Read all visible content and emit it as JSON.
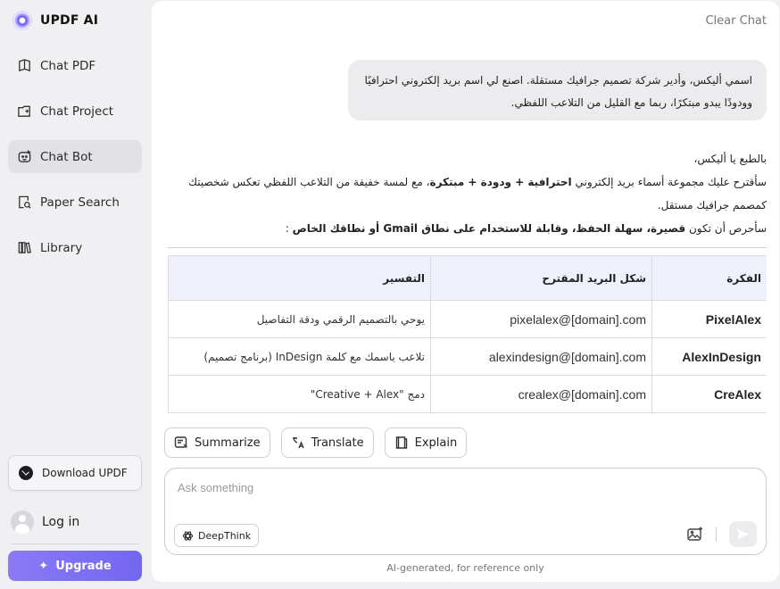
{
  "brand": {
    "name": "UPDF AI"
  },
  "nav": [
    {
      "label": "Chat PDF",
      "icon": "book-icon"
    },
    {
      "label": "Chat Project",
      "icon": "folder-icon"
    },
    {
      "label": "Chat Bot",
      "icon": "bot-icon",
      "active": true
    },
    {
      "label": "Paper Search",
      "icon": "paper-search-icon"
    },
    {
      "label": "Library",
      "icon": "library-icon"
    }
  ],
  "sidebar": {
    "download_label": "Download UPDF",
    "login_label": "Log in",
    "upgrade_label": "Upgrade"
  },
  "header": {
    "clear_chat": "Clear Chat"
  },
  "chat": {
    "user_message": "اسمي أليكس، وأدير شركة تصميم جرافيك مستقلة. اصنع لي اسم بريد إلكتروني احترافيًا وودودًا يبدو مبتكرًا، ربما مع القليل من التلاعب اللفظي.",
    "answer": {
      "greeting": "بالطبع يا أليكس،",
      "p1_a": "سأقترح عليك مجموعة أسماء بريد إلكتروني ",
      "p1_b": "احترافية + ودودة + مبتكرة",
      "p1_c": "، مع لمسة خفيفة من التلاعب اللفظي تعكس شخصيتك كمصمم جرافيك مستقل.",
      "p2_a": "سأحرص أن تكون ",
      "p2_b": "قصيرة، سهلة الحفظ، وقابلة للاستخدام على نطاق Gmail أو نطاقك الخاص",
      "p2_c": " :"
    },
    "table": {
      "headers": [
        "الفكرة",
        "شكل البريد المقترح",
        "التفسير"
      ],
      "rows": [
        {
          "idea": "PixelAlex",
          "email": "pixelalex@[domain].com",
          "explanation": "يوحي بالتصميم الرقمي ودقة التفاصيل"
        },
        {
          "idea": "AlexInDesign",
          "email": "alexindesign@[domain].com",
          "explanation": "تلاعب باسمك مع كلمة InDesign (برنامج تصميم)"
        },
        {
          "idea": "CreAlex",
          "email": "crealex@[domain].com",
          "explanation": "دمج \"Creative + Alex\""
        },
        {
          "idea": "",
          "email": "",
          "explanation": ""
        }
      ]
    }
  },
  "actions": {
    "summarize": "Summarize",
    "translate": "Translate",
    "explain": "Explain"
  },
  "composer": {
    "placeholder": "Ask something",
    "value": "",
    "deepthink": "DeepThink"
  },
  "footnote": "AI-generated, for reference only",
  "colors": {
    "accent": "#7367f0",
    "active_nav": "#e2e2e6",
    "table_header": "#eef0fb"
  }
}
